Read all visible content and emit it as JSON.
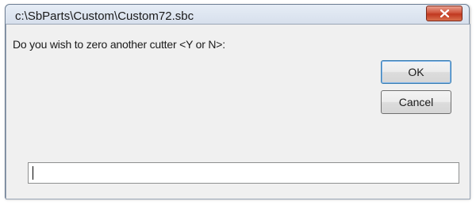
{
  "window": {
    "title": "c:\\SbParts\\Custom\\Custom72.sbc"
  },
  "dialog": {
    "prompt": "Do you wish to zero another cutter <Y or N>:",
    "ok_label": "OK",
    "cancel_label": "Cancel",
    "input_value": ""
  },
  "icons": {
    "close": "close-icon"
  },
  "colors": {
    "close_button": "#c94a30",
    "frame": "#dbe3ee"
  }
}
